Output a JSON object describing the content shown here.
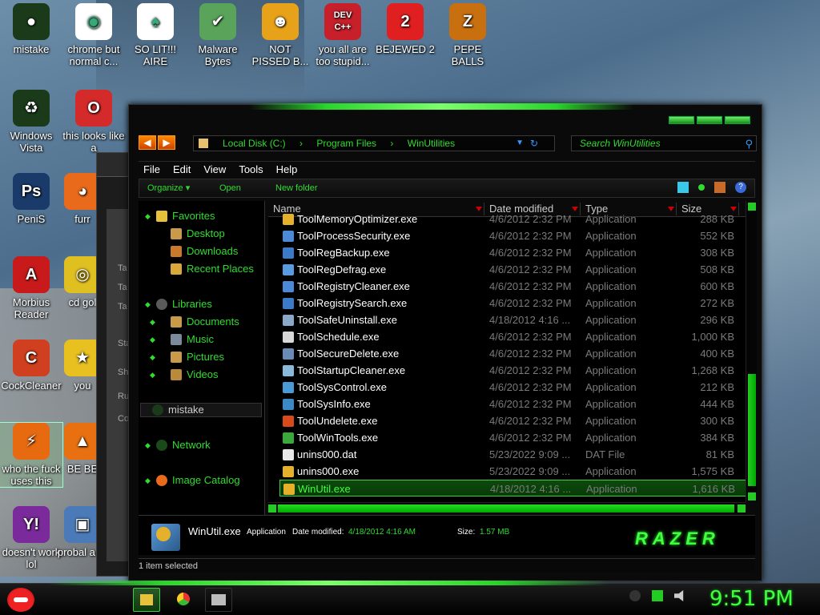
{
  "desktop": {
    "icons": [
      {
        "label": "mistake",
        "glyph": "●",
        "color": "#1a3a1a"
      },
      {
        "label": "chrome but normal c...",
        "glyph": "◉",
        "color": "#ffffff"
      },
      {
        "label": "SO LIT!!! AIRE",
        "glyph": "♠",
        "color": "#ffffff"
      },
      {
        "label": "Malware Bytes",
        "glyph": "✔",
        "color": "#5aa35a"
      },
      {
        "label": "NOT PISSED B...",
        "glyph": "☻",
        "color": "#e8a21a"
      },
      {
        "label": "you all are too stupid...",
        "glyph": "DEV C++",
        "color": "#c8202a"
      },
      {
        "label": "BEJEWED 2",
        "glyph": "2",
        "color": "#e02020"
      },
      {
        "label": "PEPE BALLS",
        "glyph": "Z",
        "color": "#c87010"
      },
      {
        "label": "Windows Vista",
        "glyph": "♻",
        "color": "#1a3a1a"
      },
      {
        "label": "this looks like a",
        "glyph": "O",
        "color": "#d42a2a"
      },
      {
        "label": "PeniS",
        "glyph": "Ps",
        "color": "#1a3a6a"
      },
      {
        "label": "furr",
        "glyph": "◕",
        "color": "#e86a1a"
      },
      {
        "label": "Morbius Reader",
        "glyph": "A",
        "color": "#c81a1a"
      },
      {
        "label": "cd gol",
        "glyph": "◎",
        "color": "#e0c020"
      },
      {
        "label": "CockCleaner",
        "glyph": "C",
        "color": "#d04020"
      },
      {
        "label": "you",
        "glyph": "★",
        "color": "#e8c020"
      },
      {
        "label": "who the fuck uses this",
        "glyph": "⚡",
        "color": "#e86a10"
      },
      {
        "label": "BE BE",
        "glyph": "▲",
        "color": "#e87010"
      },
      {
        "label": "doesn't work lol",
        "glyph": "Y!",
        "color": "#7a2a9a"
      },
      {
        "label": "probal a ro",
        "glyph": "▣",
        "color": "#4a7ab8"
      }
    ]
  },
  "bgwindow": {
    "labels": [
      "Ta",
      "Ta",
      "Ta",
      "Sta",
      "Sh",
      "Ru",
      "Co"
    ]
  },
  "explorer": {
    "address": {
      "parts": [
        "Local Disk (C:)",
        "Program Files",
        "WinUtilities"
      ]
    },
    "search_placeholder": "Search WinUtilities",
    "menu": [
      "File",
      "Edit",
      "View",
      "Tools",
      "Help"
    ],
    "toolbar": {
      "organize": "Organize",
      "open": "Open",
      "new_folder": "New folder"
    },
    "nav": {
      "favorites": "Favorites",
      "desktop": "Desktop",
      "downloads": "Downloads",
      "recent": "Recent Places",
      "libraries": "Libraries",
      "documents": "Documents",
      "music": "Music",
      "pictures": "Pictures",
      "videos": "Videos",
      "mistake": "mistake",
      "network": "Network",
      "image_catalog": "Image Catalog"
    },
    "columns": {
      "name": "Name",
      "date": "Date modified",
      "type": "Type",
      "size": "Size"
    },
    "files": [
      {
        "name": "ToolMemoryOptimizer.exe",
        "date": "4/6/2012 2:32 PM",
        "type": "Application",
        "size": "288 KB",
        "color": "#e6b12a"
      },
      {
        "name": "ToolProcessSecurity.exe",
        "date": "4/6/2012 2:32 PM",
        "type": "Application",
        "size": "552 KB",
        "color": "#4a8ad8"
      },
      {
        "name": "ToolRegBackup.exe",
        "date": "4/6/2012 2:32 PM",
        "type": "Application",
        "size": "308 KB",
        "color": "#3a7ac8"
      },
      {
        "name": "ToolRegDefrag.exe",
        "date": "4/6/2012 2:32 PM",
        "type": "Application",
        "size": "508 KB",
        "color": "#5a9ae0"
      },
      {
        "name": "ToolRegistryCleaner.exe",
        "date": "4/6/2012 2:32 PM",
        "type": "Application",
        "size": "600 KB",
        "color": "#4a8ad8"
      },
      {
        "name": "ToolRegistrySearch.exe",
        "date": "4/6/2012 2:32 PM",
        "type": "Application",
        "size": "272 KB",
        "color": "#3a7ac8"
      },
      {
        "name": "ToolSafeUninstall.exe",
        "date": "4/18/2012 4:16 ...",
        "type": "Application",
        "size": "296 KB",
        "color": "#8aa8c8"
      },
      {
        "name": "ToolSchedule.exe",
        "date": "4/6/2012 2:32 PM",
        "type": "Application",
        "size": "1,000 KB",
        "color": "#d8d8d8"
      },
      {
        "name": "ToolSecureDelete.exe",
        "date": "4/6/2012 2:32 PM",
        "type": "Application",
        "size": "400 KB",
        "color": "#6a8ab8"
      },
      {
        "name": "ToolStartupCleaner.exe",
        "date": "4/6/2012 2:32 PM",
        "type": "Application",
        "size": "1,268 KB",
        "color": "#8ab8d8"
      },
      {
        "name": "ToolSysControl.exe",
        "date": "4/6/2012 2:32 PM",
        "type": "Application",
        "size": "212 KB",
        "color": "#4a9ad8"
      },
      {
        "name": "ToolSysInfo.exe",
        "date": "4/6/2012 2:32 PM",
        "type": "Application",
        "size": "444 KB",
        "color": "#3a8ac8"
      },
      {
        "name": "ToolUndelete.exe",
        "date": "4/6/2012 2:32 PM",
        "type": "Application",
        "size": "300 KB",
        "color": "#d84a1a"
      },
      {
        "name": "ToolWinTools.exe",
        "date": "4/6/2012 2:32 PM",
        "type": "Application",
        "size": "384 KB",
        "color": "#3aa83a"
      },
      {
        "name": "unins000.dat",
        "date": "5/23/2022 9:09 ...",
        "type": "DAT File",
        "size": "81 KB",
        "color": "#e8e8e8"
      },
      {
        "name": "unins000.exe",
        "date": "5/23/2022 9:09 ...",
        "type": "Application",
        "size": "1,575 KB",
        "color": "#e6b12a"
      },
      {
        "name": "WinUtil.exe",
        "date": "4/18/2012 4:16 ...",
        "type": "Application",
        "size": "1,616 KB",
        "color": "#e6b12a"
      }
    ],
    "selected_index": 16,
    "details": {
      "name": "WinUtil.exe",
      "type": "Application",
      "date_label": "Date modified:",
      "date_value": "4/18/2012 4:16 AM",
      "size_label": "Size:",
      "size_value": "1.57 MB",
      "logo": "RAZER"
    },
    "status": "1 item selected"
  },
  "taskbar": {
    "clock": "9:51 PM"
  },
  "colors": {
    "accent": "#2fdc2f",
    "selection": "#0c4a0c"
  }
}
